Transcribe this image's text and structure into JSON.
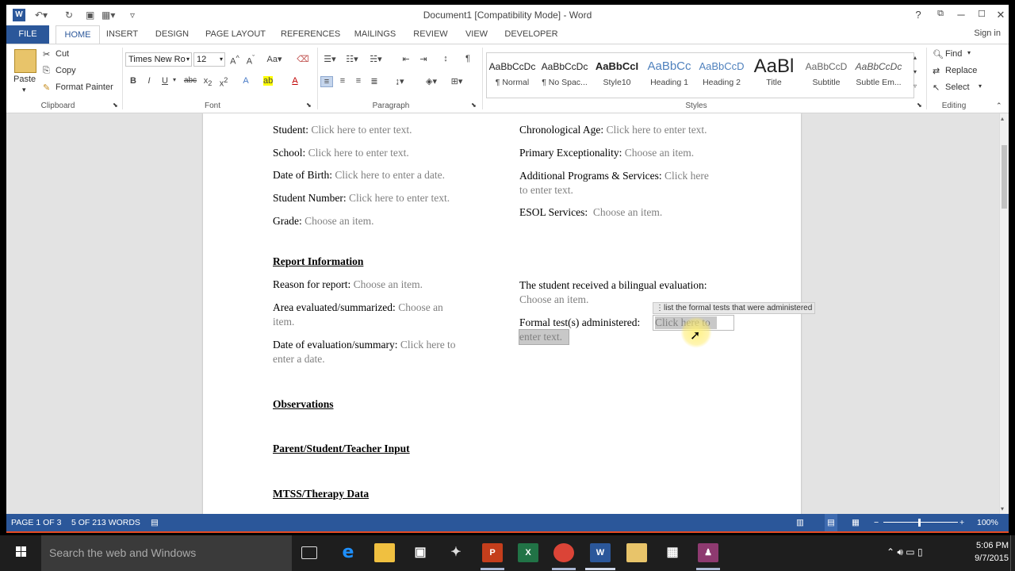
{
  "window": {
    "title": "Document1 [Compatibility Mode] - Word",
    "help": "?",
    "minimize": "─",
    "maximize": "☐",
    "close": "✕"
  },
  "tabs": [
    {
      "label": "FILE"
    },
    {
      "label": "HOME"
    },
    {
      "label": "INSERT"
    },
    {
      "label": "DESIGN"
    },
    {
      "label": "PAGE LAYOUT"
    },
    {
      "label": "REFERENCES"
    },
    {
      "label": "MAILINGS"
    },
    {
      "label": "REVIEW"
    },
    {
      "label": "VIEW"
    },
    {
      "label": "DEVELOPER"
    }
  ],
  "signin": "Sign in",
  "clipboard": {
    "label": "Clipboard",
    "paste": "Paste",
    "cut": "Cut",
    "copy": "Copy",
    "format_painter": "Format Painter"
  },
  "font": {
    "label": "Font",
    "family": "Times New Ro",
    "size": "12"
  },
  "paragraph": {
    "label": "Paragraph"
  },
  "styles": {
    "label": "Styles",
    "items": [
      {
        "sample": "AaBbCcDc",
        "name": "¶ Normal"
      },
      {
        "sample": "AaBbCcDc",
        "name": "¶ No Spac..."
      },
      {
        "sample": "AaBbCcI",
        "name": "Style10"
      },
      {
        "sample": "AaBbCc",
        "name": "Heading 1"
      },
      {
        "sample": "AaBbCcD",
        "name": "Heading 2"
      },
      {
        "sample": "AaBl",
        "name": "Title"
      },
      {
        "sample": "AaBbCcD",
        "name": "Subtitle"
      },
      {
        "sample": "AaBbCcDc",
        "name": "Subtle Em..."
      }
    ]
  },
  "editing": {
    "label": "Editing",
    "find": "Find",
    "replace": "Replace",
    "select": "Select"
  },
  "document": {
    "left_fields": [
      {
        "label": "Student:",
        "value": "Click here to enter text."
      },
      {
        "label": "School:",
        "value": "Click here to enter text."
      },
      {
        "label": "Date of Birth:",
        "value": "Click here to enter a date."
      },
      {
        "label": "Student Number:",
        "value": "Click here to enter text."
      },
      {
        "label": "Grade:",
        "value": "Choose an item."
      }
    ],
    "right_fields": [
      {
        "label": "Chronological Age:",
        "value": "Click here to enter text."
      },
      {
        "label": "Primary Exceptionality:",
        "value": "Choose an item."
      },
      {
        "label": "Additional Programs & Services:",
        "value": "Click here",
        "value2": "to enter text."
      },
      {
        "label": "ESOL Services:",
        "value": "Choose an item."
      }
    ],
    "report_heading": "Report Information",
    "report_left": [
      {
        "label": "Reason for report:",
        "value": "Choose an item."
      },
      {
        "label": "Area evaluated/summarized:",
        "value": "Choose an",
        "value2": "item."
      },
      {
        "label": "Date of evaluation/summary:",
        "value": "Click here to",
        "value2": "enter a date."
      }
    ],
    "bilingual_label": "The student received a bilingual evaluation:",
    "bilingual_value": "Choose an item.",
    "formal_label": "Formal test(s) administered:",
    "formal_value": "Click here to",
    "formal_value2": "enter text.",
    "tooltip": "list the formal tests that were administered",
    "headings": [
      "Observations",
      "Parent/Student/Teacher Input",
      "MTSS/Therapy Data"
    ]
  },
  "statusbar": {
    "page": "PAGE 1 OF 3",
    "words": "5 OF 213 WORDS",
    "zoom": "100%"
  },
  "taskbar": {
    "search_placeholder": "Search the web and Windows",
    "time": "5:06 PM",
    "date": "9/7/2015"
  },
  "colors": {
    "word_blue": "#2b579a",
    "placeholder_gray": "#808080",
    "taskbar": "#1e1e1e"
  }
}
